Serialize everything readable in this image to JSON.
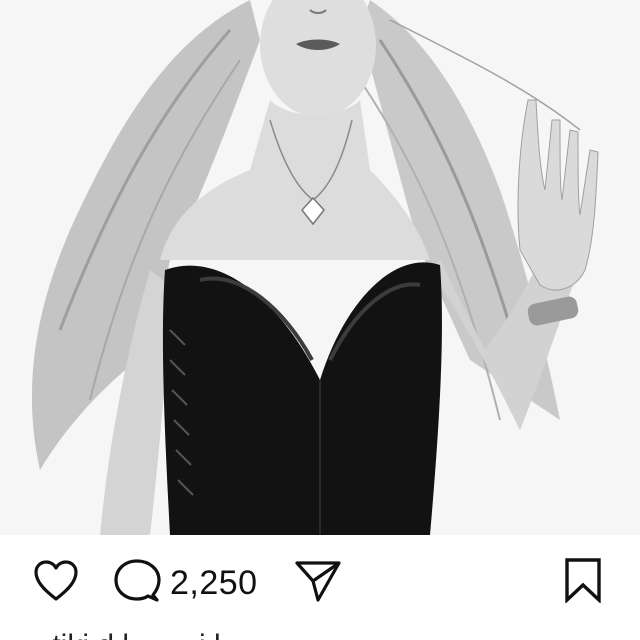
{
  "post": {
    "image": {
      "subject": "black-and-white portrait photo",
      "colors": {
        "background": "#f6f6f6",
        "garment": "#121212",
        "skin": "#d9d9d9",
        "hair": "#bdbdbd"
      }
    },
    "actions": {
      "like_icon": "heart-icon",
      "comment_icon": "speech-bubble-icon",
      "comment_count": "2,250",
      "share_icon": "paper-plane-icon",
      "save_icon": "bookmark-icon"
    },
    "caption_peek": "· tiki d l .. ·  · i l"
  }
}
